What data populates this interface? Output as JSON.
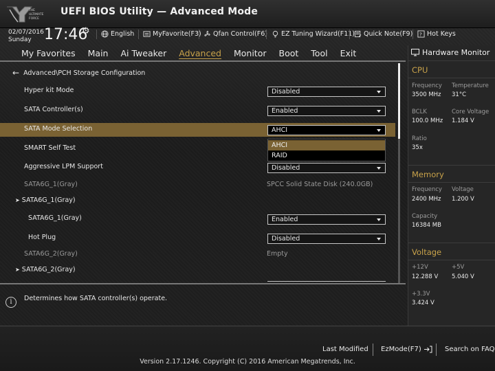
{
  "app": {
    "logo_text": "THE ULTIMATE FORCE",
    "title": "UEFI BIOS Utility — Advanced Mode"
  },
  "status": {
    "date": "02/07/2016",
    "day": "Sunday",
    "time": "17:46"
  },
  "toolbar": {
    "language": "English",
    "myfavorite": "MyFavorite(F3)",
    "qfan": "Qfan Control(F6)",
    "ez_tuning": "EZ Tuning Wizard(F11)",
    "quick_note": "Quick Note(F9)",
    "hot_keys": "Hot Keys"
  },
  "nav": {
    "tabs": [
      "My Favorites",
      "Main",
      "Ai Tweaker",
      "Advanced",
      "Monitor",
      "Boot",
      "Tool",
      "Exit"
    ],
    "active": "Advanced"
  },
  "breadcrumb": "Advanced\\PCH Storage Configuration",
  "settings": [
    {
      "label": "Hyper kit Mode",
      "value": "Disabled"
    },
    {
      "label": "SATA Controller(s)",
      "value": "Enabled"
    },
    {
      "label": "SATA Mode Selection",
      "value": "AHCI"
    },
    {
      "label": "SMART Self Test",
      "value": ""
    },
    {
      "label": "Aggressive LPM Support",
      "value": "Disabled"
    },
    {
      "label": "SATA6G_1(Gray)",
      "value": "SPCC Solid State Disk (240.0GB)"
    },
    {
      "label": "SATA6G_1(Gray)",
      "value": ""
    },
    {
      "label": "SATA6G_1(Gray)",
      "value": "Enabled"
    },
    {
      "label": "Hot Plug",
      "value": "Disabled"
    },
    {
      "label": "SATA6G_2(Gray)",
      "value": "Empty"
    },
    {
      "label": "SATA6G_2(Gray)",
      "value": ""
    }
  ],
  "popup": {
    "options": [
      "AHCI",
      "RAID"
    ],
    "highlighted": "AHCI"
  },
  "help": {
    "text": "Determines how SATA controller(s) operate."
  },
  "hw_monitor": {
    "title": "Hardware Monitor",
    "cpu": {
      "title": "CPU",
      "frequency_label": "Frequency",
      "frequency": "3500 MHz",
      "temperature_label": "Temperature",
      "temperature": "31°C",
      "bclk_label": "BCLK",
      "bclk": "100.0 MHz",
      "core_voltage_label": "Core Voltage",
      "core_voltage": "1.184 V",
      "ratio_label": "Ratio",
      "ratio": "35x"
    },
    "memory": {
      "title": "Memory",
      "frequency_label": "Frequency",
      "frequency": "2400 MHz",
      "voltage_label": "Voltage",
      "voltage": "1.200 V",
      "capacity_label": "Capacity",
      "capacity": "16384 MB"
    },
    "voltage": {
      "title": "Voltage",
      "v12_label": "+12V",
      "v12": "12.288 V",
      "v5_label": "+5V",
      "v5": "5.040 V",
      "v33_label": "+3.3V",
      "v33": "3.424 V"
    }
  },
  "footer": {
    "last_modified": "Last Modified",
    "ezmode": "EzMode(F7)",
    "search": "Search on FAQ",
    "copyright": "Version 2.17.1246. Copyright (C) 2016 American Megatrends, Inc."
  },
  "colors": {
    "accent": "#c8a24a",
    "selection": "#7a6233"
  }
}
